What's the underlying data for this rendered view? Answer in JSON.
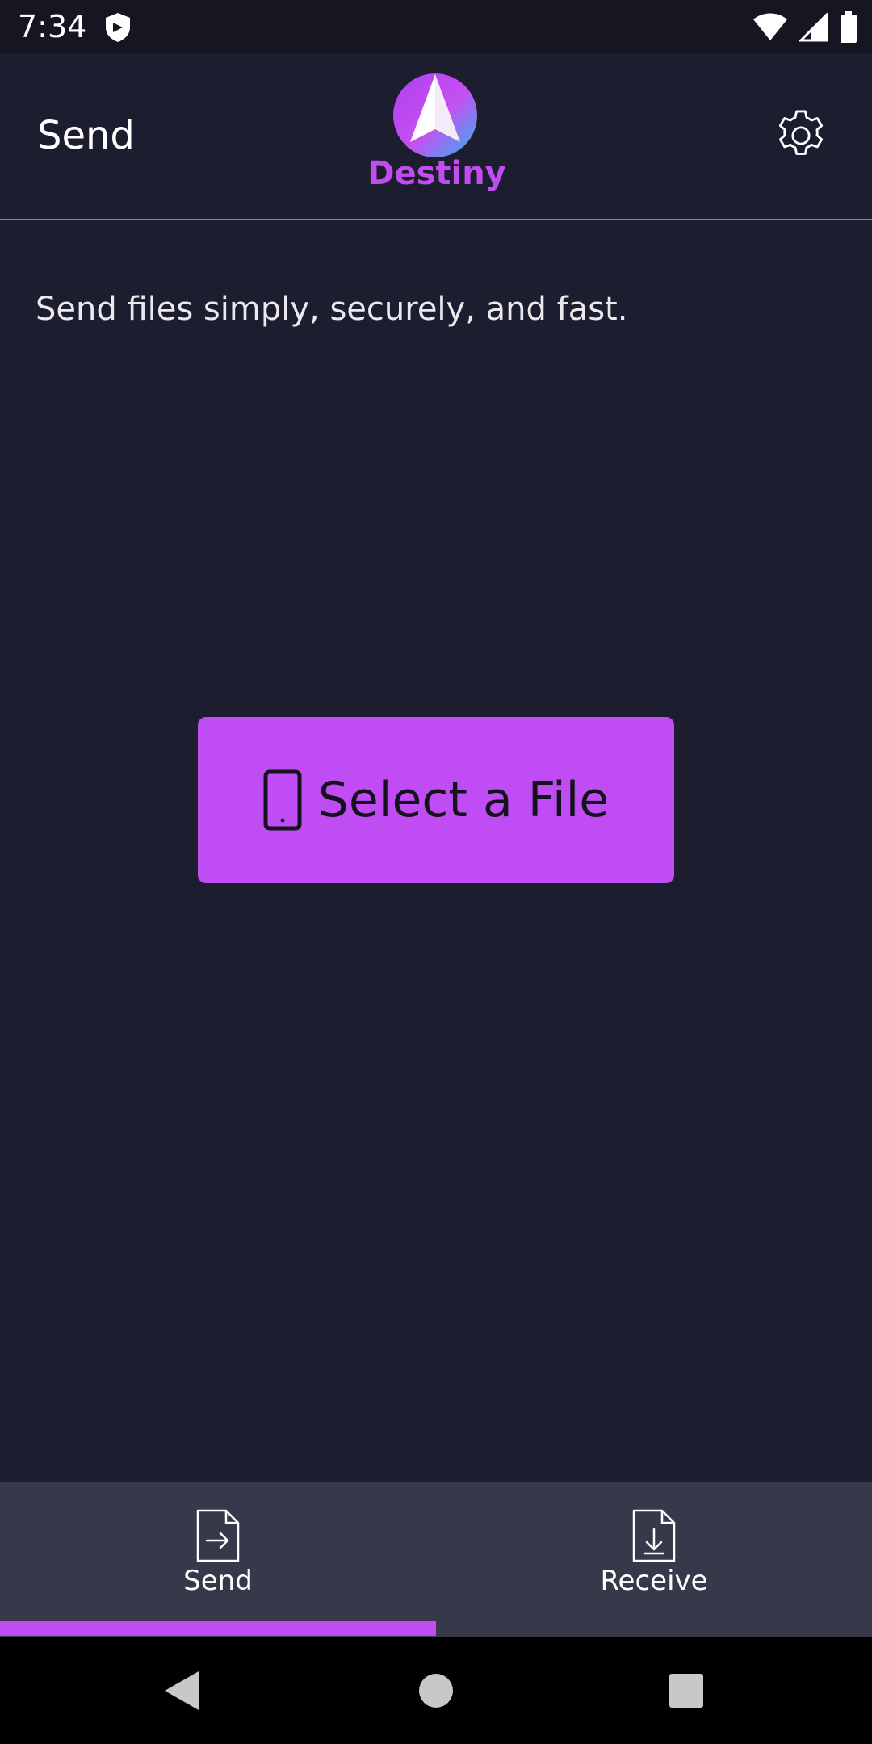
{
  "status_bar": {
    "time": "7:34"
  },
  "app_bar": {
    "title": "Send",
    "logo_text": "Destiny"
  },
  "main": {
    "tagline": "Send files simply, securely, and fast.",
    "select_file_label": "Select a File"
  },
  "tabs": [
    {
      "label": "Send",
      "icon": "send-file-icon",
      "selected": true
    },
    {
      "label": "Receive",
      "icon": "receive-file-icon",
      "selected": false
    }
  ],
  "colors": {
    "background": "#1c1d2e",
    "accent": "#c04cf4",
    "tab_bar": "#373849"
  }
}
